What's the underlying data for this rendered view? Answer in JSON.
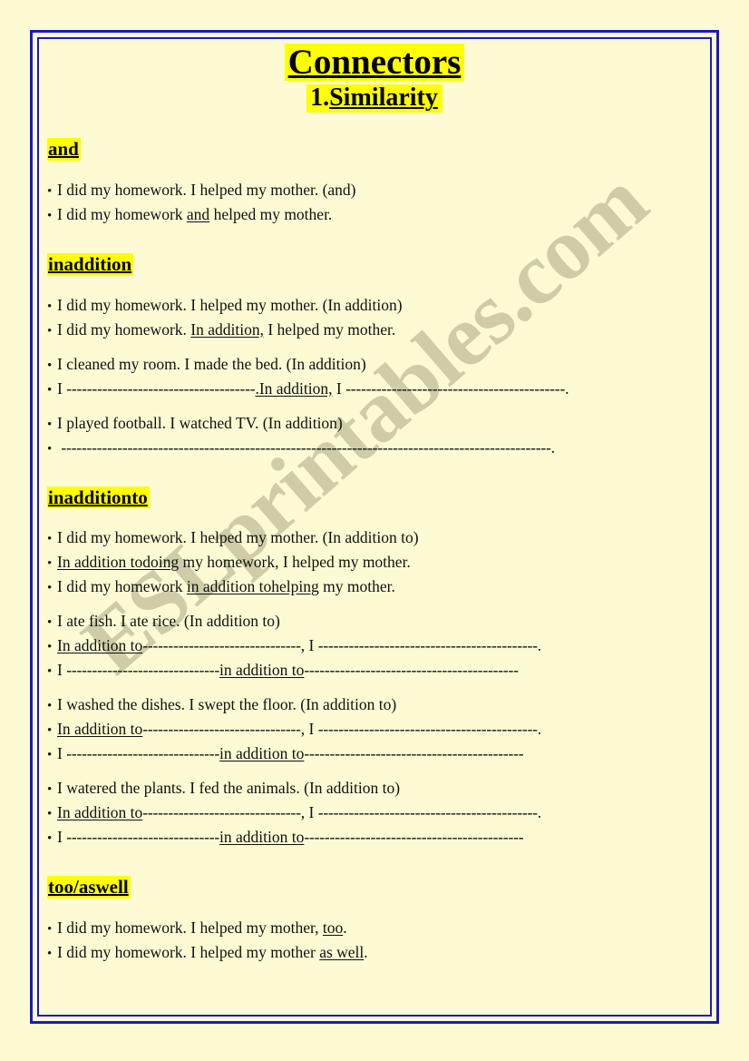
{
  "page": {
    "background_color": "#fcfbd4",
    "border_color": "#1a19c4",
    "highlight_color": "#ffff00",
    "watermark_color": "#cfcca8",
    "watermark_text": "ESLprintables.com"
  },
  "title": {
    "main": "Connectors",
    "sub_number": "1.",
    "sub_word": "Similarity"
  },
  "sections": [
    {
      "heading": "and",
      "lines": [
        {
          "bullet": "•",
          "parts": [
            {
              "t": "I did my homework. I helped my mother. (and)"
            }
          ]
        },
        {
          "bullet": "•",
          "parts": [
            {
              "t": "I did my homework "
            },
            {
              "t": "and",
              "u": true
            },
            {
              "t": " helped my mother."
            }
          ]
        }
      ]
    },
    {
      "heading": "inaddition",
      "lines": [
        {
          "bullet": "•",
          "parts": [
            {
              "t": "I did my homework. I helped my mother. (In addition)"
            }
          ]
        },
        {
          "bullet": "•",
          "parts": [
            {
              "t": "I did my homework. "
            },
            {
              "t": "In addition,",
              "u": true
            },
            {
              "t": " I helped my mother."
            }
          ]
        },
        {
          "gap": "sm",
          "bullet": "•",
          "parts": [
            {
              "t": "I cleaned my room. I made the bed. (In addition)"
            }
          ]
        },
        {
          "bullet": "•",
          "parts": [
            {
              "t": "I "
            },
            {
              "t": "-------------------------------------",
              "dash": true
            },
            {
              "t": ".In addition,",
              "u": true
            },
            {
              "t": " I "
            },
            {
              "t": "-------------------------------------------",
              "dash": true
            },
            {
              "t": "."
            }
          ]
        },
        {
          "gap": "sm",
          "bullet": "•",
          "parts": [
            {
              "t": "I played football. I watched TV. (In addition)"
            }
          ]
        },
        {
          "bullet": "•",
          "parts": [
            {
              "t": " "
            },
            {
              "t": "------------------------------------------------------------------------------------------------",
              "dash": true
            },
            {
              "t": "."
            }
          ]
        }
      ]
    },
    {
      "heading": "inadditionto",
      "lines": [
        {
          "bullet": "•",
          "parts": [
            {
              "t": "I did my homework. I helped my mother. (In addition to)"
            }
          ]
        },
        {
          "bullet": "•",
          "parts": [
            {
              "t": "In addition todoing",
              "u": true
            },
            {
              "t": " my homework, I helped my mother."
            }
          ]
        },
        {
          "bullet": "•",
          "parts": [
            {
              "t": "I did my homework "
            },
            {
              "t": "in addition tohelping",
              "u": true
            },
            {
              "t": " my mother."
            }
          ]
        },
        {
          "gap": "sm",
          "bullet": "•",
          "parts": [
            {
              "t": "I ate fish. I ate rice. (In addition to)"
            }
          ]
        },
        {
          "bullet": "•",
          "parts": [
            {
              "t": "In addition to",
              "u": true
            },
            {
              "t": "-------------------------------",
              "dash": true
            },
            {
              "t": ", I "
            },
            {
              "t": "-------------------------------------------",
              "dash": true
            },
            {
              "t": "."
            }
          ]
        },
        {
          "bullet": "•",
          "parts": [
            {
              "t": "I "
            },
            {
              "t": "------------------------------",
              "dash": true
            },
            {
              "t": "in addition to",
              "u": true
            },
            {
              "t": "------------------------------------------",
              "dash": true
            }
          ]
        },
        {
          "gap": "sm",
          "bullet": "•",
          "parts": [
            {
              "t": "I washed the dishes. I swept the floor. (In addition to)"
            }
          ]
        },
        {
          "bullet": "•",
          "parts": [
            {
              "t": "In addition to",
              "u": true
            },
            {
              "t": "-------------------------------",
              "dash": true
            },
            {
              "t": ", I "
            },
            {
              "t": "-------------------------------------------",
              "dash": true
            },
            {
              "t": "."
            }
          ]
        },
        {
          "bullet": "•",
          "parts": [
            {
              "t": "I "
            },
            {
              "t": "------------------------------",
              "dash": true
            },
            {
              "t": "in addition to",
              "u": true
            },
            {
              "t": "-------------------------------------------",
              "dash": true
            }
          ]
        },
        {
          "gap": "sm",
          "bullet": "•",
          "parts": [
            {
              "t": "I watered the plants. I fed the animals."
            },
            {
              "t": "                            "
            },
            {
              "t": "(In addition to)"
            }
          ]
        },
        {
          "bullet": "•",
          "parts": [
            {
              "t": "In addition to",
              "u": true
            },
            {
              "t": "-------------------------------",
              "dash": true
            },
            {
              "t": ", I "
            },
            {
              "t": "-------------------------------------------",
              "dash": true
            },
            {
              "t": "."
            }
          ]
        },
        {
          "bullet": "•",
          "parts": [
            {
              "t": "I "
            },
            {
              "t": "------------------------------",
              "dash": true
            },
            {
              "t": "in addition to",
              "u": true
            },
            {
              "t": "-------------------------------------------",
              "dash": true
            }
          ]
        }
      ]
    },
    {
      "heading": "too/aswell",
      "lines": [
        {
          "bullet": "•",
          "parts": [
            {
              "t": "I did my homework. I helped my mother, "
            },
            {
              "t": "too",
              "u": true
            },
            {
              "t": "."
            }
          ]
        },
        {
          "bullet": "•",
          "parts": [
            {
              "t": "I did my homework. I helped my mother "
            },
            {
              "t": "as well",
              "u": true
            },
            {
              "t": "."
            }
          ]
        }
      ]
    }
  ]
}
